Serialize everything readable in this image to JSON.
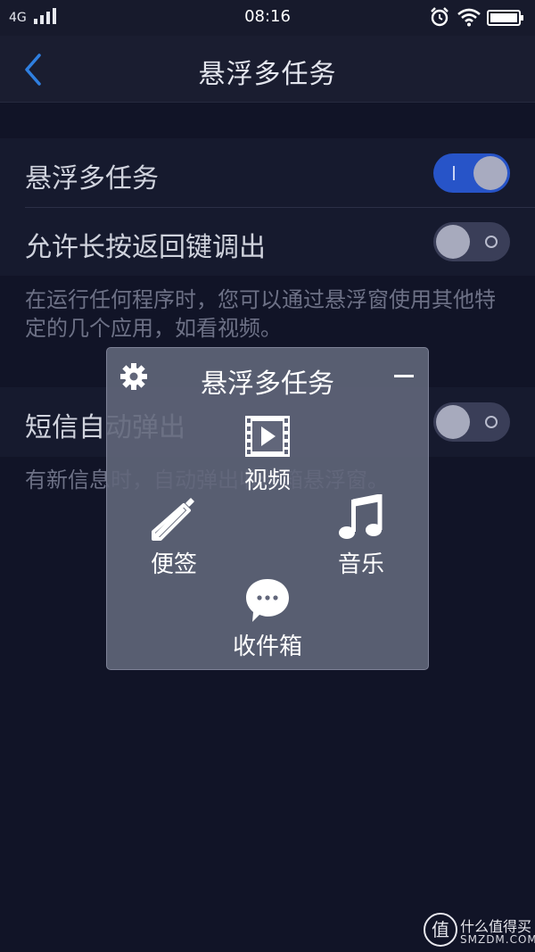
{
  "status_bar": {
    "network": "4G",
    "time": "08:16"
  },
  "header": {
    "title": "悬浮多任务"
  },
  "settings": {
    "floating_multitask": {
      "label": "悬浮多任务",
      "enabled": true
    },
    "long_press_back": {
      "label": "允许长按返回键调出",
      "enabled": false
    },
    "description": "在运行任何程序时，您可以通过悬浮窗使用其他特定的几个应用，如看视频。",
    "sms_popup": {
      "label": "短信自动弹出",
      "enabled": false
    },
    "sms_description": "有新信息时，自动弹出收件箱悬浮窗。"
  },
  "floating_panel": {
    "title": "悬浮多任务",
    "apps": [
      {
        "label": "视频",
        "icon": "video-icon"
      },
      {
        "label": "便签",
        "icon": "pencil-icon"
      },
      {
        "label": "音乐",
        "icon": "music-note-icon"
      },
      {
        "label": "收件箱",
        "icon": "chat-bubble-icon"
      }
    ]
  },
  "watermark": {
    "logo_char": "值",
    "text": "什么值得买",
    "sub": "SMZDM.COM"
  },
  "colors": {
    "background": "#111427",
    "row_background": "#161a2e",
    "toggle_on": "#2754c8",
    "toggle_off": "#3a3e58",
    "panel": "#61667a"
  }
}
